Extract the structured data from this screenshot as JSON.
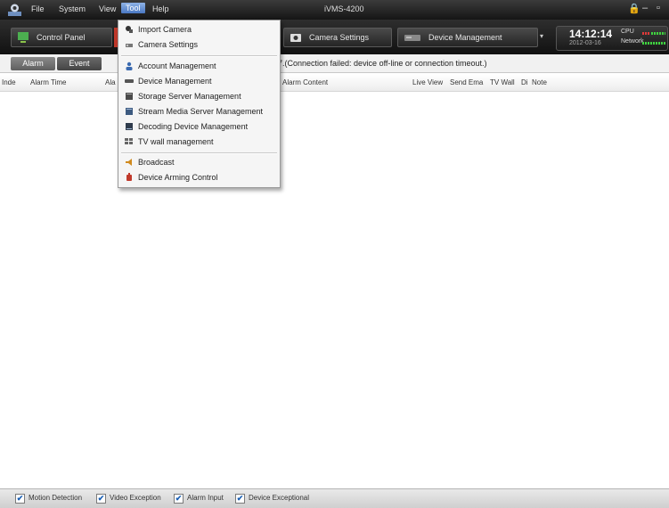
{
  "window": {
    "title": "iVMS-4200",
    "controls": {
      "lock": "🔒",
      "minimize": "–",
      "close": "▫"
    }
  },
  "menu": {
    "items": [
      "File",
      "System",
      "View",
      "Tool",
      "Help"
    ],
    "active": "Tool"
  },
  "toolbar": {
    "buttons": [
      {
        "label": "Control Panel",
        "icon": "control-panel-icon"
      },
      {
        "label": "Camera Settings",
        "icon": "camera-settings-icon"
      },
      {
        "label": "Device Management",
        "icon": "device-management-icon"
      }
    ],
    "clock": {
      "time": "14:12:14",
      "date": "2012-03-16"
    },
    "resources": {
      "cpu_label": "CPU",
      "network_label": "Network"
    }
  },
  "tabs": {
    "alarm": "Alarm",
    "event": "Event"
  },
  "status_message": "7.(Connection failed: device off-line or connection timeout.)",
  "table": {
    "columns": [
      "Inde",
      "Alarm Time",
      "Ala",
      "Alarm Content",
      "Live View",
      "Send Ema",
      "TV Wall",
      "Di",
      "Note"
    ],
    "rows": []
  },
  "tool_menu": {
    "items": [
      {
        "label": "Import Camera",
        "icon": "import-camera-icon"
      },
      {
        "label": "Camera Settings",
        "icon": "camera-settings-icon"
      },
      {
        "label": "Account Management",
        "icon": "account-icon"
      },
      {
        "label": "Device Management",
        "icon": "device-icon"
      },
      {
        "label": "Storage Server Management",
        "icon": "storage-server-icon"
      },
      {
        "label": "Stream Media Server Management",
        "icon": "stream-media-icon"
      },
      {
        "label": "Decoding Device Management",
        "icon": "decoding-device-icon"
      },
      {
        "label": "TV wall management",
        "icon": "tv-wall-icon"
      },
      {
        "label": "Broadcast",
        "icon": "broadcast-icon"
      },
      {
        "label": "Device Arming Control",
        "icon": "arming-control-icon"
      }
    ]
  },
  "filters": [
    {
      "label": "Motion Detection",
      "checked": true
    },
    {
      "label": "Video Exception",
      "checked": true
    },
    {
      "label": "Alarm Input",
      "checked": true
    },
    {
      "label": "Device Exceptional",
      "checked": true
    }
  ],
  "check_mark": "✔",
  "colors": {
    "accent": "#4a78c2",
    "alarm_red": "#c0392b",
    "meter_green": "#3fd13f"
  }
}
